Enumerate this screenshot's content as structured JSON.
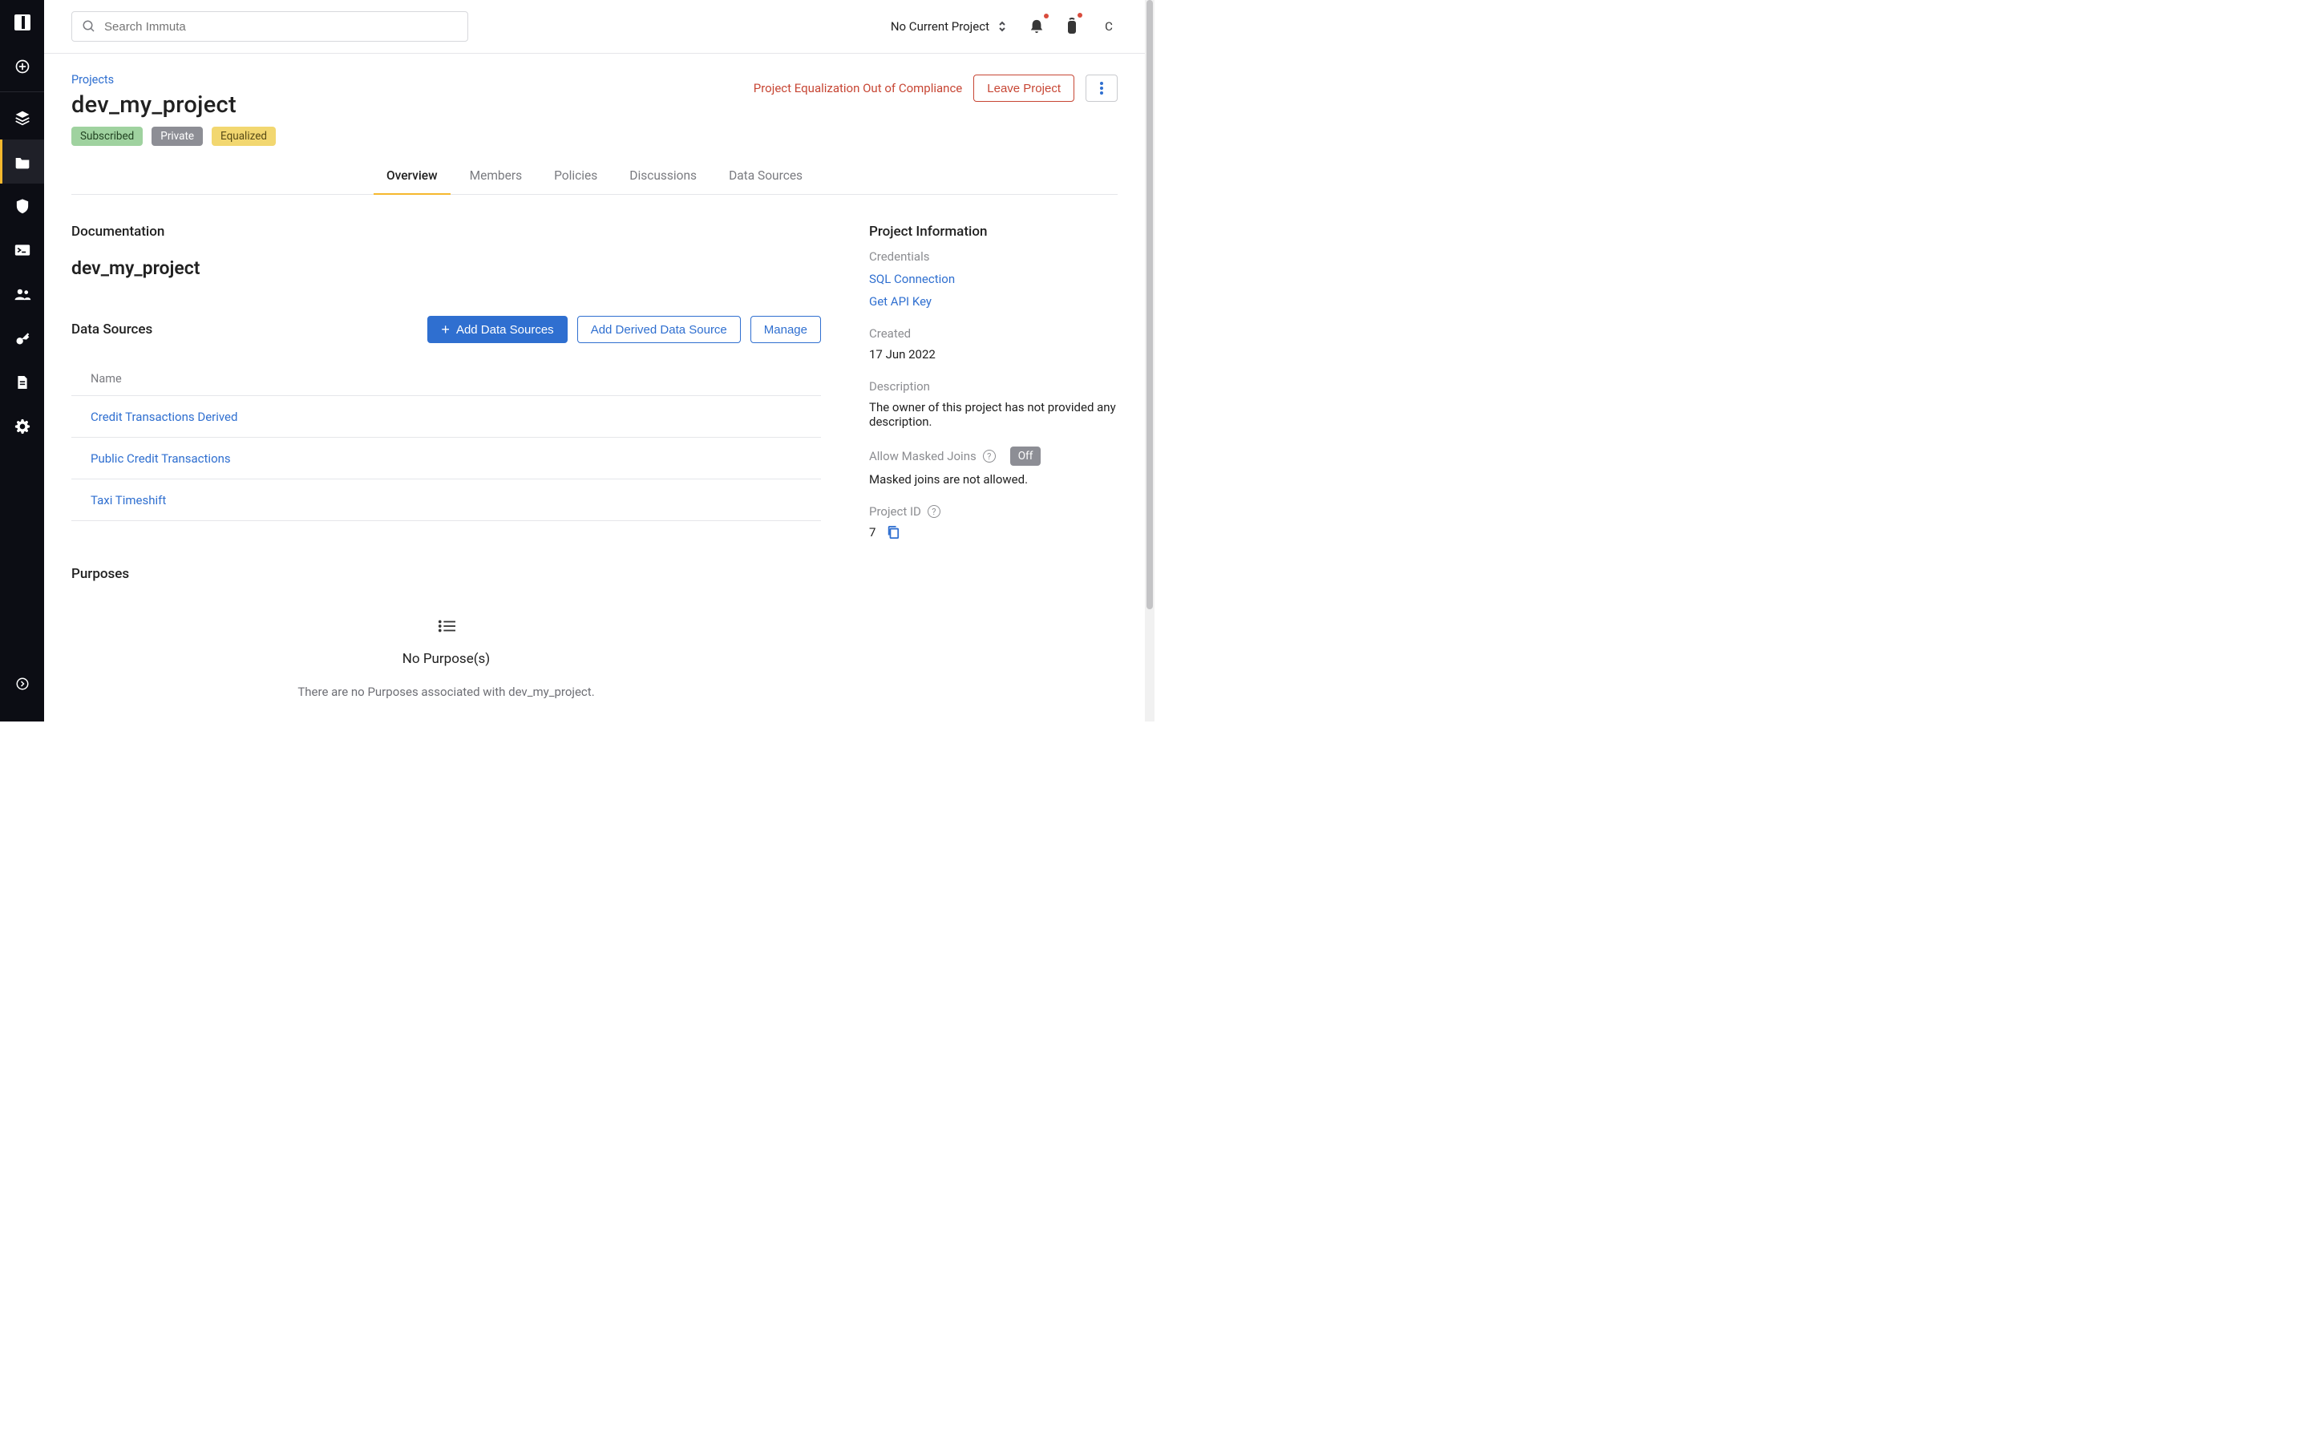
{
  "search": {
    "placeholder": "Search Immuta"
  },
  "topbar": {
    "project_switcher": "No Current Project",
    "avatar": "C"
  },
  "breadcrumb": {
    "projects": "Projects"
  },
  "project": {
    "title": "dev_my_project",
    "chips": {
      "subscribed": "Subscribed",
      "private": "Private",
      "equalized": "Equalized"
    },
    "compliance_warning": "Project Equalization Out of Compliance",
    "leave_label": "Leave Project"
  },
  "tabs": {
    "overview": "Overview",
    "members": "Members",
    "policies": "Policies",
    "discussions": "Discussions",
    "data_sources": "Data Sources"
  },
  "documentation": {
    "heading": "Documentation",
    "title": "dev_my_project"
  },
  "data_sources": {
    "heading": "Data Sources",
    "add_label": "Add Data Sources",
    "add_derived_label": "Add Derived Data Source",
    "manage_label": "Manage",
    "col_name": "Name",
    "rows": [
      {
        "name": "Credit Transactions Derived"
      },
      {
        "name": "Public Credit Transactions"
      },
      {
        "name": "Taxi Timeshift"
      }
    ]
  },
  "purposes": {
    "heading": "Purposes",
    "empty_title": "No Purpose(s)",
    "empty_sub": "There are no Purposes associated with dev_my_project."
  },
  "info": {
    "heading": "Project Information",
    "credentials_label": "Credentials",
    "sql_connection": "SQL Connection",
    "get_api_key": "Get API Key",
    "created_label": "Created",
    "created_value": "17 Jun 2022",
    "description_label": "Description",
    "description_value": "The owner of this project has not provided any description.",
    "masked_joins_label": "Allow Masked Joins",
    "masked_joins_state": "Off",
    "masked_joins_desc": "Masked joins are not allowed.",
    "project_id_label": "Project ID",
    "project_id_value": "7"
  }
}
